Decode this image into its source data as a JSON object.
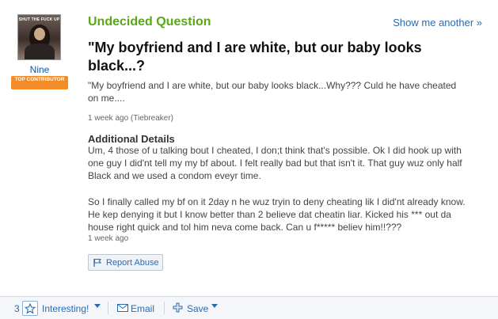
{
  "asker": {
    "avatar_caption": "SHUT THE FUCK UP",
    "name": "Nine",
    "badge": "TOP CONTRIBUTOR"
  },
  "question": {
    "type_label": "Undecided Question",
    "show_another": "Show me another »",
    "title": "\"My boyfriend and I are white, but our baby looks black...?",
    "body": "\"My boyfriend and I are white, but our baby looks black...Why??? Culd he have cheated on me....",
    "meta": "1 week ago (Tiebreaker)"
  },
  "details": {
    "heading": "Additional Details",
    "paragraph1": "Um, 4 those of u talking bout I cheated, I don;t think that's possible. Ok I did hook up with one guy I did'nt tell my my bf about. I felt really bad but that isn't it. That guy wuz only half Black and we used a condom eveyr time.",
    "paragraph2": "So I finally called my bf on it 2day n he wuz tryin to deny cheating lik I did'nt already know. He kep denying it but I know better than 2 believe dat cheatin liar. Kicked his *** out da house right quick and tol him neva come back. Can u f***** believ him!!???",
    "meta": "1 week ago"
  },
  "report_abuse": "Report Abuse",
  "actions": {
    "count": "3",
    "interesting": "Interesting!",
    "email": "Email",
    "save": "Save"
  },
  "colors": {
    "question_type": "#5aa718",
    "link": "#2a6cb0",
    "badge": "#f28c28"
  },
  "icons": [
    "flag-icon",
    "star-icon",
    "email-icon",
    "plus-icon",
    "caret-down-icon"
  ]
}
